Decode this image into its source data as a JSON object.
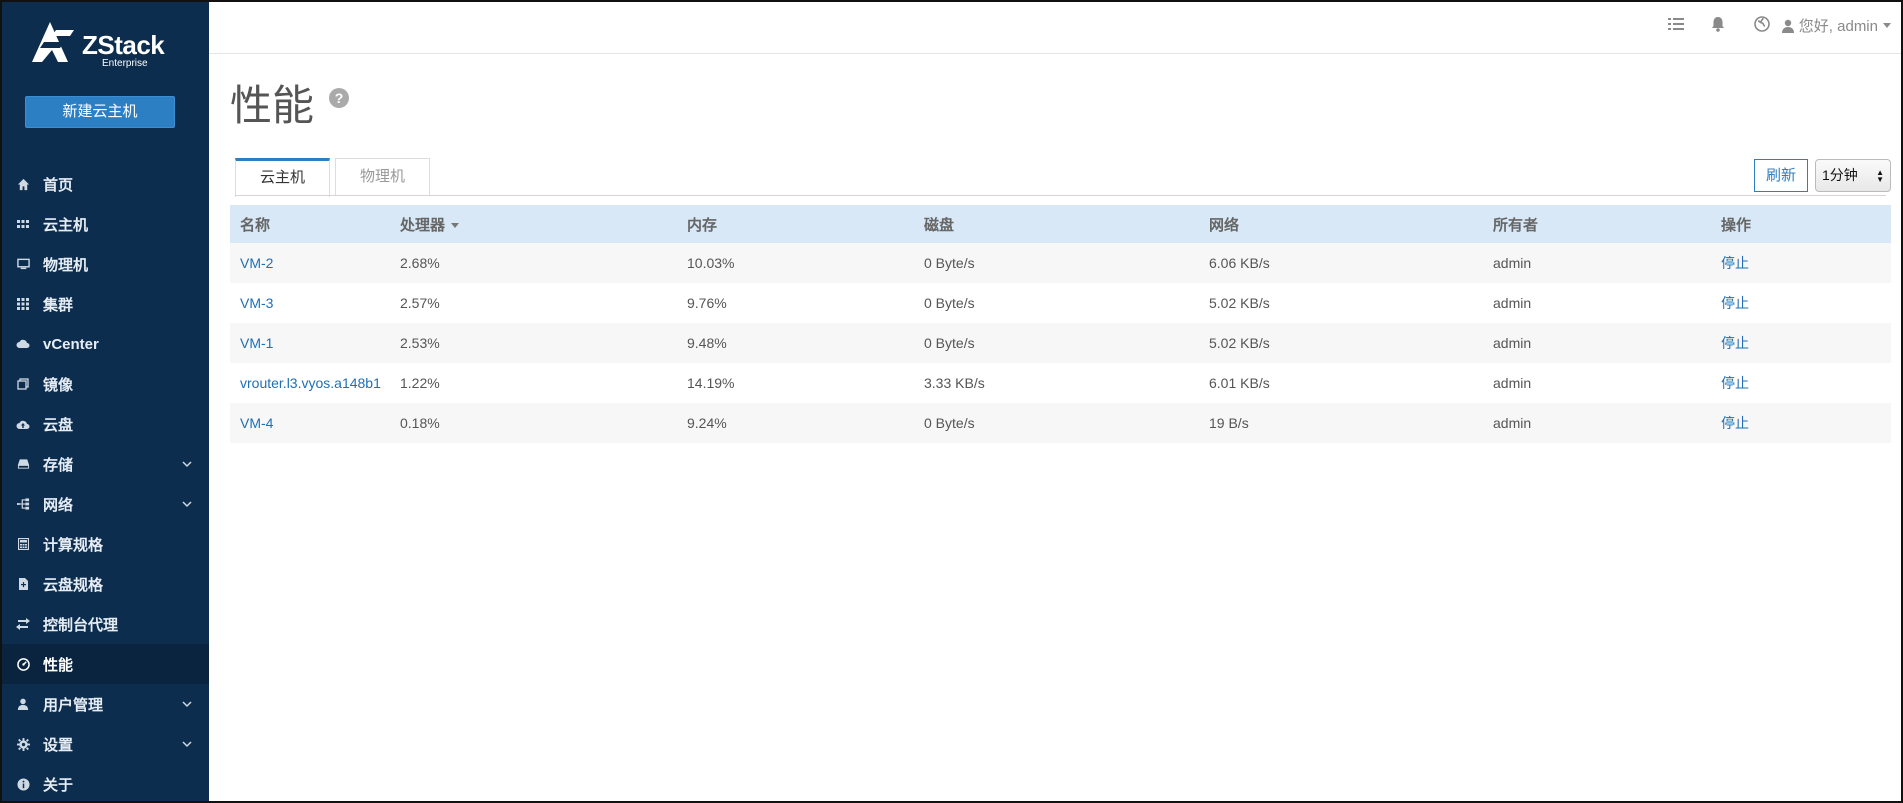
{
  "app": {
    "logo_text": "ZStack",
    "logo_sub": "Enterprise",
    "new_vm_button": "新建云主机"
  },
  "sidebar": {
    "items": [
      {
        "label": "首页",
        "icon": "home-icon",
        "chevron": false
      },
      {
        "label": "云主机",
        "icon": "grid-icon",
        "chevron": false
      },
      {
        "label": "物理机",
        "icon": "monitor-icon",
        "chevron": false
      },
      {
        "label": "集群",
        "icon": "apps-icon",
        "chevron": false
      },
      {
        "label": "vCenter",
        "icon": "cloud-icon",
        "chevron": false
      },
      {
        "label": "镜像",
        "icon": "copy-icon",
        "chevron": false
      },
      {
        "label": "云盘",
        "icon": "cloud-upload-icon",
        "chevron": false
      },
      {
        "label": "存储",
        "icon": "hdd-icon",
        "chevron": true
      },
      {
        "label": "网络",
        "icon": "network-icon",
        "chevron": true
      },
      {
        "label": "计算规格",
        "icon": "calculator-icon",
        "chevron": false
      },
      {
        "label": "云盘规格",
        "icon": "file-icon",
        "chevron": false
      },
      {
        "label": "控制台代理",
        "icon": "exchange-icon",
        "chevron": false
      },
      {
        "label": "性能",
        "icon": "dashboard-icon",
        "chevron": false,
        "active": true
      },
      {
        "label": "用户管理",
        "icon": "user-icon",
        "chevron": true
      },
      {
        "label": "设置",
        "icon": "gear-icon",
        "chevron": true
      },
      {
        "label": "关于",
        "icon": "info-icon",
        "chevron": false
      }
    ]
  },
  "topbar": {
    "user_greeting": "您好, admin"
  },
  "page": {
    "title": "性能",
    "help": "?"
  },
  "tabs": [
    {
      "label": "云主机",
      "active": true
    },
    {
      "label": "物理机",
      "active": false
    }
  ],
  "controls": {
    "refresh_label": "刷新",
    "interval_value": "1分钟"
  },
  "table": {
    "headers": [
      "名称",
      "处理器",
      "内存",
      "磁盘",
      "网络",
      "所有者",
      "操作"
    ],
    "rows": [
      {
        "name": "VM-2",
        "cpu": "2.68%",
        "mem": "10.03%",
        "disk": "0 Byte/s",
        "net": "6.06 KB/s",
        "owner": "admin",
        "action": "停止"
      },
      {
        "name": "VM-3",
        "cpu": "2.57%",
        "mem": "9.76%",
        "disk": "0 Byte/s",
        "net": "5.02 KB/s",
        "owner": "admin",
        "action": "停止"
      },
      {
        "name": "VM-1",
        "cpu": "2.53%",
        "mem": "9.48%",
        "disk": "0 Byte/s",
        "net": "5.02 KB/s",
        "owner": "admin",
        "action": "停止"
      },
      {
        "name": "vrouter.l3.vyos.a148b1",
        "cpu": "1.22%",
        "mem": "14.19%",
        "disk": "3.33 KB/s",
        "net": "6.01 KB/s",
        "owner": "admin",
        "action": "停止"
      },
      {
        "name": "VM-4",
        "cpu": "0.18%",
        "mem": "9.24%",
        "disk": "0 Byte/s",
        "net": "19 B/s",
        "owner": "admin",
        "action": "停止"
      }
    ]
  },
  "colors": {
    "sidebar_bg": "#0d2d4e",
    "accent": "#2d7fc4",
    "table_header_bg": "#d8e8f7"
  }
}
